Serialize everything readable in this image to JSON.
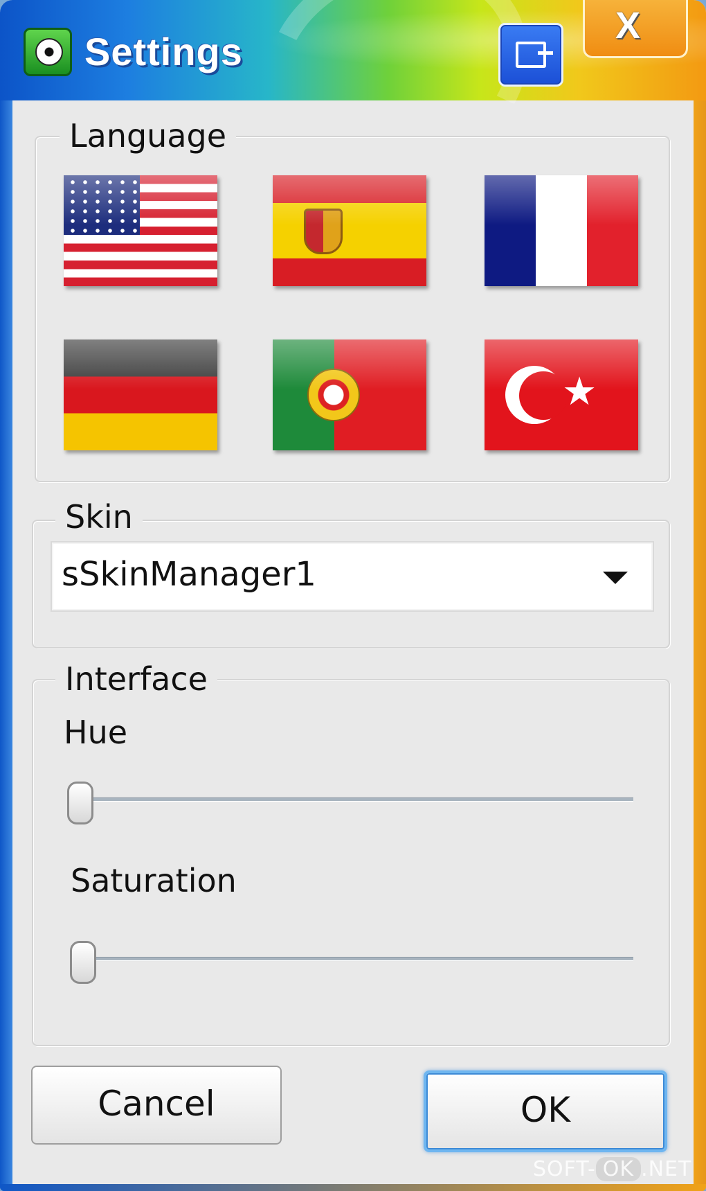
{
  "window": {
    "title": "Settings",
    "minimize_icon": "minimize-icon",
    "close_label": "X"
  },
  "language": {
    "legend": "Language",
    "flags": [
      {
        "name": "us"
      },
      {
        "name": "es"
      },
      {
        "name": "fr"
      },
      {
        "name": "de"
      },
      {
        "name": "pt"
      },
      {
        "name": "tr"
      }
    ]
  },
  "skin": {
    "legend": "Skin",
    "selected": "sSkinManager1"
  },
  "interface": {
    "legend": "Interface",
    "hue_label": "Hue",
    "hue_value": 0,
    "saturation_label": "Saturation",
    "saturation_value": 0
  },
  "buttons": {
    "cancel": "Cancel",
    "ok": "OK"
  },
  "watermark": {
    "prefix": "SOFT-",
    "mid": "OK",
    "suffix": ".NET"
  }
}
